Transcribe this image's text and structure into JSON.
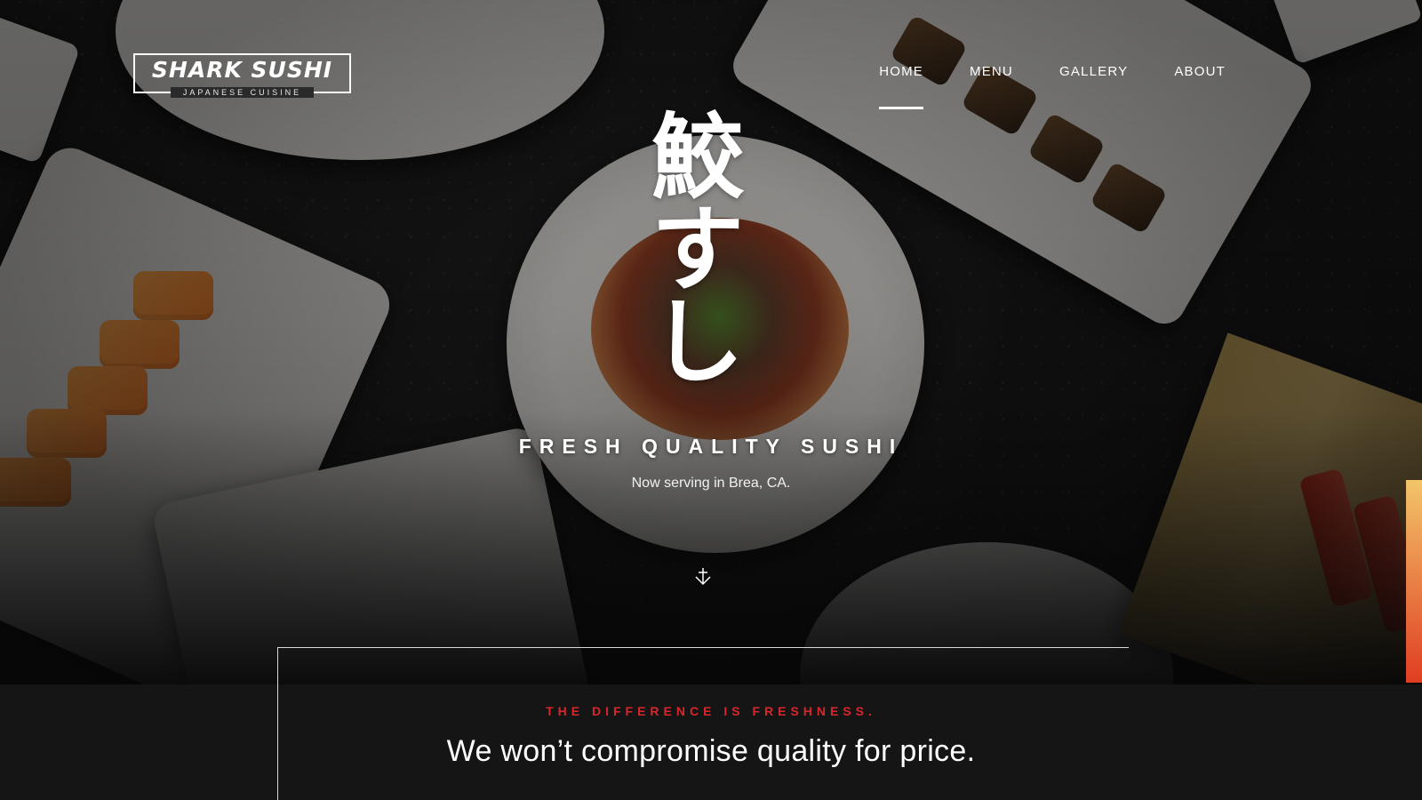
{
  "header": {
    "logo_title": "SHARK SUSHI",
    "logo_subtitle": "JAPANESE CUISINE",
    "nav": [
      {
        "label": "HOME",
        "active": true
      },
      {
        "label": "MENU",
        "active": false
      },
      {
        "label": "GALLERY",
        "active": false
      },
      {
        "label": "ABOUT",
        "active": false
      }
    ]
  },
  "hero": {
    "kanji": [
      "鮫",
      "す",
      "し"
    ],
    "tagline": "FRESH QUALITY SUSHI",
    "subline": "Now serving in Brea, CA.",
    "scroll_icon": "anchor-down-arrow-icon"
  },
  "difference": {
    "eyebrow": "THE DIFFERENCE IS FRESHNESS.",
    "headline": "We won’t compromise quality for price."
  },
  "colors": {
    "accent_red": "#d8262b",
    "text_white": "#ffffff",
    "background_dark": "#0b0b0c"
  }
}
